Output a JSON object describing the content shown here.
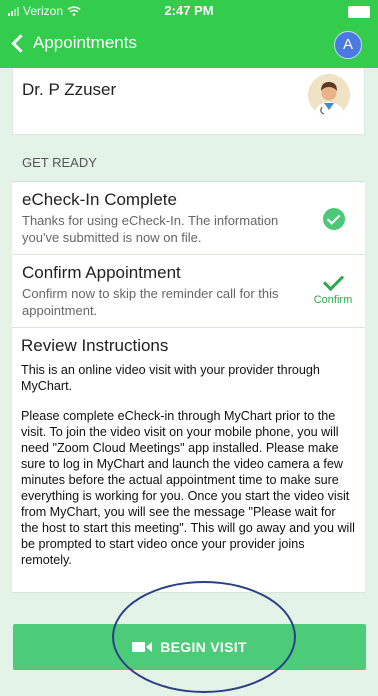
{
  "status_bar": {
    "carrier": "Verizon",
    "time": "2:47 PM"
  },
  "nav": {
    "back_label": "Appointments",
    "avatar_letter": "A"
  },
  "provider": {
    "name": "Dr. P Zzuser"
  },
  "get_ready": {
    "header": "GET READY",
    "echeckin": {
      "title": "eCheck-In Complete",
      "description": "Thanks for using eCheck-In. The information you've submitted is now on file."
    },
    "confirm": {
      "title": "Confirm Appointment",
      "description": "Confirm now to skip the reminder call for this appointment.",
      "button_label": "Confirm"
    },
    "instructions": {
      "title": "Review Instructions",
      "paragraph1": "This is an online video visit with your provider through MyChart.",
      "paragraph2": "Please complete eCheck-in through MyChart prior to the visit. To join the video visit on your mobile phone, you will need \"Zoom Cloud Meetings\" app installed. Please make sure to log in MyChart and launch the video camera a few minutes before the actual appointment time to make sure everything is working for you. Once you start the video visit from MyChart, you will see the message \"Please wait for the host to start this meeting\". This will go away and you will be prompted to start video once your provider joins remotely."
    }
  },
  "begin_visit": {
    "label": "BEGIN VISIT"
  },
  "colors": {
    "brand_green": "#33cc4c",
    "button_green": "#4ccc79",
    "annotation_oval": "#2b3f8a"
  }
}
